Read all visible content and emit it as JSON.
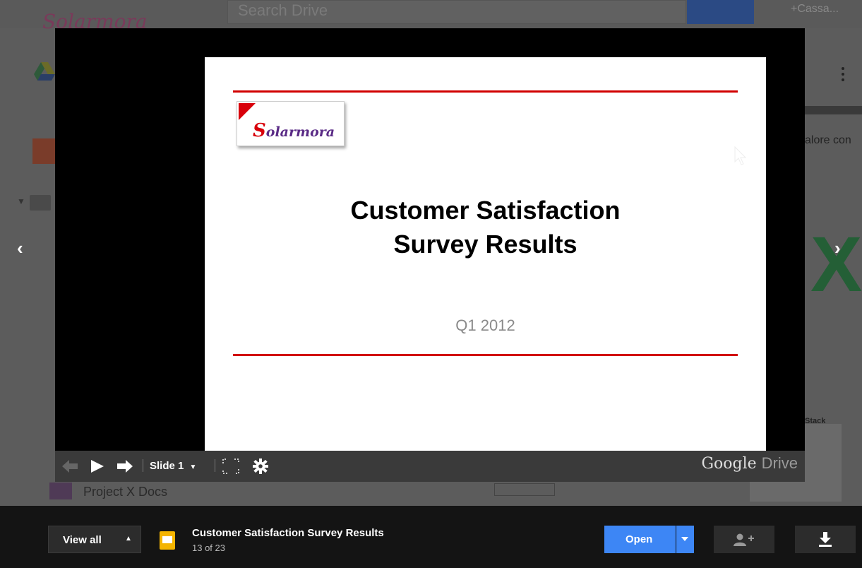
{
  "background": {
    "search_placeholder": "Search Drive",
    "user_label": "+Cassa...",
    "brand_text": "Solarmora",
    "side_text": "alore con",
    "folder_name": "Project X Docs",
    "thumb_label": "Stack",
    "big_letter": "X"
  },
  "slide": {
    "logo_text_initial": "S",
    "logo_text_rest": "olarmora",
    "title_line1": "Customer Satisfaction",
    "title_line2": "Survey  Results",
    "subtitle": "Q1 2012",
    "colors": {
      "rule": "#d10000",
      "logo_accent": "#d8000a",
      "logo_text": "#5a2b86"
    }
  },
  "toolbar": {
    "slide_label": "Slide 1",
    "branding_google": "Google",
    "branding_drive": "Drive"
  },
  "nav": {
    "prev_icon": "chevron-left-icon",
    "next_icon": "chevron-right-icon"
  },
  "bottom": {
    "view_all_label": "View all",
    "file_name": "Customer Satisfaction Survey Results",
    "file_position": "13 of 23",
    "open_label": "Open",
    "colors": {
      "open_button": "#3d86f5",
      "file_icon": "#f4b400"
    }
  }
}
